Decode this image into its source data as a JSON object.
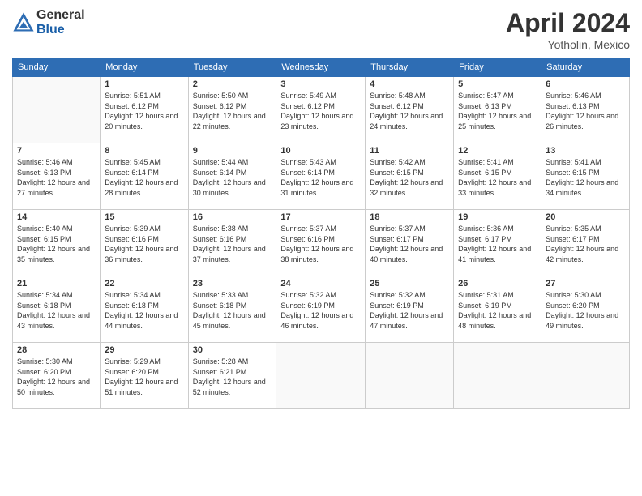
{
  "header": {
    "logo_general": "General",
    "logo_blue": "Blue",
    "month_year": "April 2024",
    "location": "Yotholin, Mexico"
  },
  "days_of_week": [
    "Sunday",
    "Monday",
    "Tuesday",
    "Wednesday",
    "Thursday",
    "Friday",
    "Saturday"
  ],
  "weeks": [
    [
      {
        "day": "",
        "empty": true
      },
      {
        "day": "1",
        "sunrise": "Sunrise: 5:51 AM",
        "sunset": "Sunset: 6:12 PM",
        "daylight": "Daylight: 12 hours and 20 minutes."
      },
      {
        "day": "2",
        "sunrise": "Sunrise: 5:50 AM",
        "sunset": "Sunset: 6:12 PM",
        "daylight": "Daylight: 12 hours and 22 minutes."
      },
      {
        "day": "3",
        "sunrise": "Sunrise: 5:49 AM",
        "sunset": "Sunset: 6:12 PM",
        "daylight": "Daylight: 12 hours and 23 minutes."
      },
      {
        "day": "4",
        "sunrise": "Sunrise: 5:48 AM",
        "sunset": "Sunset: 6:12 PM",
        "daylight": "Daylight: 12 hours and 24 minutes."
      },
      {
        "day": "5",
        "sunrise": "Sunrise: 5:47 AM",
        "sunset": "Sunset: 6:13 PM",
        "daylight": "Daylight: 12 hours and 25 minutes."
      },
      {
        "day": "6",
        "sunrise": "Sunrise: 5:46 AM",
        "sunset": "Sunset: 6:13 PM",
        "daylight": "Daylight: 12 hours and 26 minutes."
      }
    ],
    [
      {
        "day": "7",
        "sunrise": "Sunrise: 5:46 AM",
        "sunset": "Sunset: 6:13 PM",
        "daylight": "Daylight: 12 hours and 27 minutes."
      },
      {
        "day": "8",
        "sunrise": "Sunrise: 5:45 AM",
        "sunset": "Sunset: 6:14 PM",
        "daylight": "Daylight: 12 hours and 28 minutes."
      },
      {
        "day": "9",
        "sunrise": "Sunrise: 5:44 AM",
        "sunset": "Sunset: 6:14 PM",
        "daylight": "Daylight: 12 hours and 30 minutes."
      },
      {
        "day": "10",
        "sunrise": "Sunrise: 5:43 AM",
        "sunset": "Sunset: 6:14 PM",
        "daylight": "Daylight: 12 hours and 31 minutes."
      },
      {
        "day": "11",
        "sunrise": "Sunrise: 5:42 AM",
        "sunset": "Sunset: 6:15 PM",
        "daylight": "Daylight: 12 hours and 32 minutes."
      },
      {
        "day": "12",
        "sunrise": "Sunrise: 5:41 AM",
        "sunset": "Sunset: 6:15 PM",
        "daylight": "Daylight: 12 hours and 33 minutes."
      },
      {
        "day": "13",
        "sunrise": "Sunrise: 5:41 AM",
        "sunset": "Sunset: 6:15 PM",
        "daylight": "Daylight: 12 hours and 34 minutes."
      }
    ],
    [
      {
        "day": "14",
        "sunrise": "Sunrise: 5:40 AM",
        "sunset": "Sunset: 6:15 PM",
        "daylight": "Daylight: 12 hours and 35 minutes."
      },
      {
        "day": "15",
        "sunrise": "Sunrise: 5:39 AM",
        "sunset": "Sunset: 6:16 PM",
        "daylight": "Daylight: 12 hours and 36 minutes."
      },
      {
        "day": "16",
        "sunrise": "Sunrise: 5:38 AM",
        "sunset": "Sunset: 6:16 PM",
        "daylight": "Daylight: 12 hours and 37 minutes."
      },
      {
        "day": "17",
        "sunrise": "Sunrise: 5:37 AM",
        "sunset": "Sunset: 6:16 PM",
        "daylight": "Daylight: 12 hours and 38 minutes."
      },
      {
        "day": "18",
        "sunrise": "Sunrise: 5:37 AM",
        "sunset": "Sunset: 6:17 PM",
        "daylight": "Daylight: 12 hours and 40 minutes."
      },
      {
        "day": "19",
        "sunrise": "Sunrise: 5:36 AM",
        "sunset": "Sunset: 6:17 PM",
        "daylight": "Daylight: 12 hours and 41 minutes."
      },
      {
        "day": "20",
        "sunrise": "Sunrise: 5:35 AM",
        "sunset": "Sunset: 6:17 PM",
        "daylight": "Daylight: 12 hours and 42 minutes."
      }
    ],
    [
      {
        "day": "21",
        "sunrise": "Sunrise: 5:34 AM",
        "sunset": "Sunset: 6:18 PM",
        "daylight": "Daylight: 12 hours and 43 minutes."
      },
      {
        "day": "22",
        "sunrise": "Sunrise: 5:34 AM",
        "sunset": "Sunset: 6:18 PM",
        "daylight": "Daylight: 12 hours and 44 minutes."
      },
      {
        "day": "23",
        "sunrise": "Sunrise: 5:33 AM",
        "sunset": "Sunset: 6:18 PM",
        "daylight": "Daylight: 12 hours and 45 minutes."
      },
      {
        "day": "24",
        "sunrise": "Sunrise: 5:32 AM",
        "sunset": "Sunset: 6:19 PM",
        "daylight": "Daylight: 12 hours and 46 minutes."
      },
      {
        "day": "25",
        "sunrise": "Sunrise: 5:32 AM",
        "sunset": "Sunset: 6:19 PM",
        "daylight": "Daylight: 12 hours and 47 minutes."
      },
      {
        "day": "26",
        "sunrise": "Sunrise: 5:31 AM",
        "sunset": "Sunset: 6:19 PM",
        "daylight": "Daylight: 12 hours and 48 minutes."
      },
      {
        "day": "27",
        "sunrise": "Sunrise: 5:30 AM",
        "sunset": "Sunset: 6:20 PM",
        "daylight": "Daylight: 12 hours and 49 minutes."
      }
    ],
    [
      {
        "day": "28",
        "sunrise": "Sunrise: 5:30 AM",
        "sunset": "Sunset: 6:20 PM",
        "daylight": "Daylight: 12 hours and 50 minutes."
      },
      {
        "day": "29",
        "sunrise": "Sunrise: 5:29 AM",
        "sunset": "Sunset: 6:20 PM",
        "daylight": "Daylight: 12 hours and 51 minutes."
      },
      {
        "day": "30",
        "sunrise": "Sunrise: 5:28 AM",
        "sunset": "Sunset: 6:21 PM",
        "daylight": "Daylight: 12 hours and 52 minutes."
      },
      {
        "day": "",
        "empty": true
      },
      {
        "day": "",
        "empty": true
      },
      {
        "day": "",
        "empty": true
      },
      {
        "day": "",
        "empty": true
      }
    ]
  ]
}
